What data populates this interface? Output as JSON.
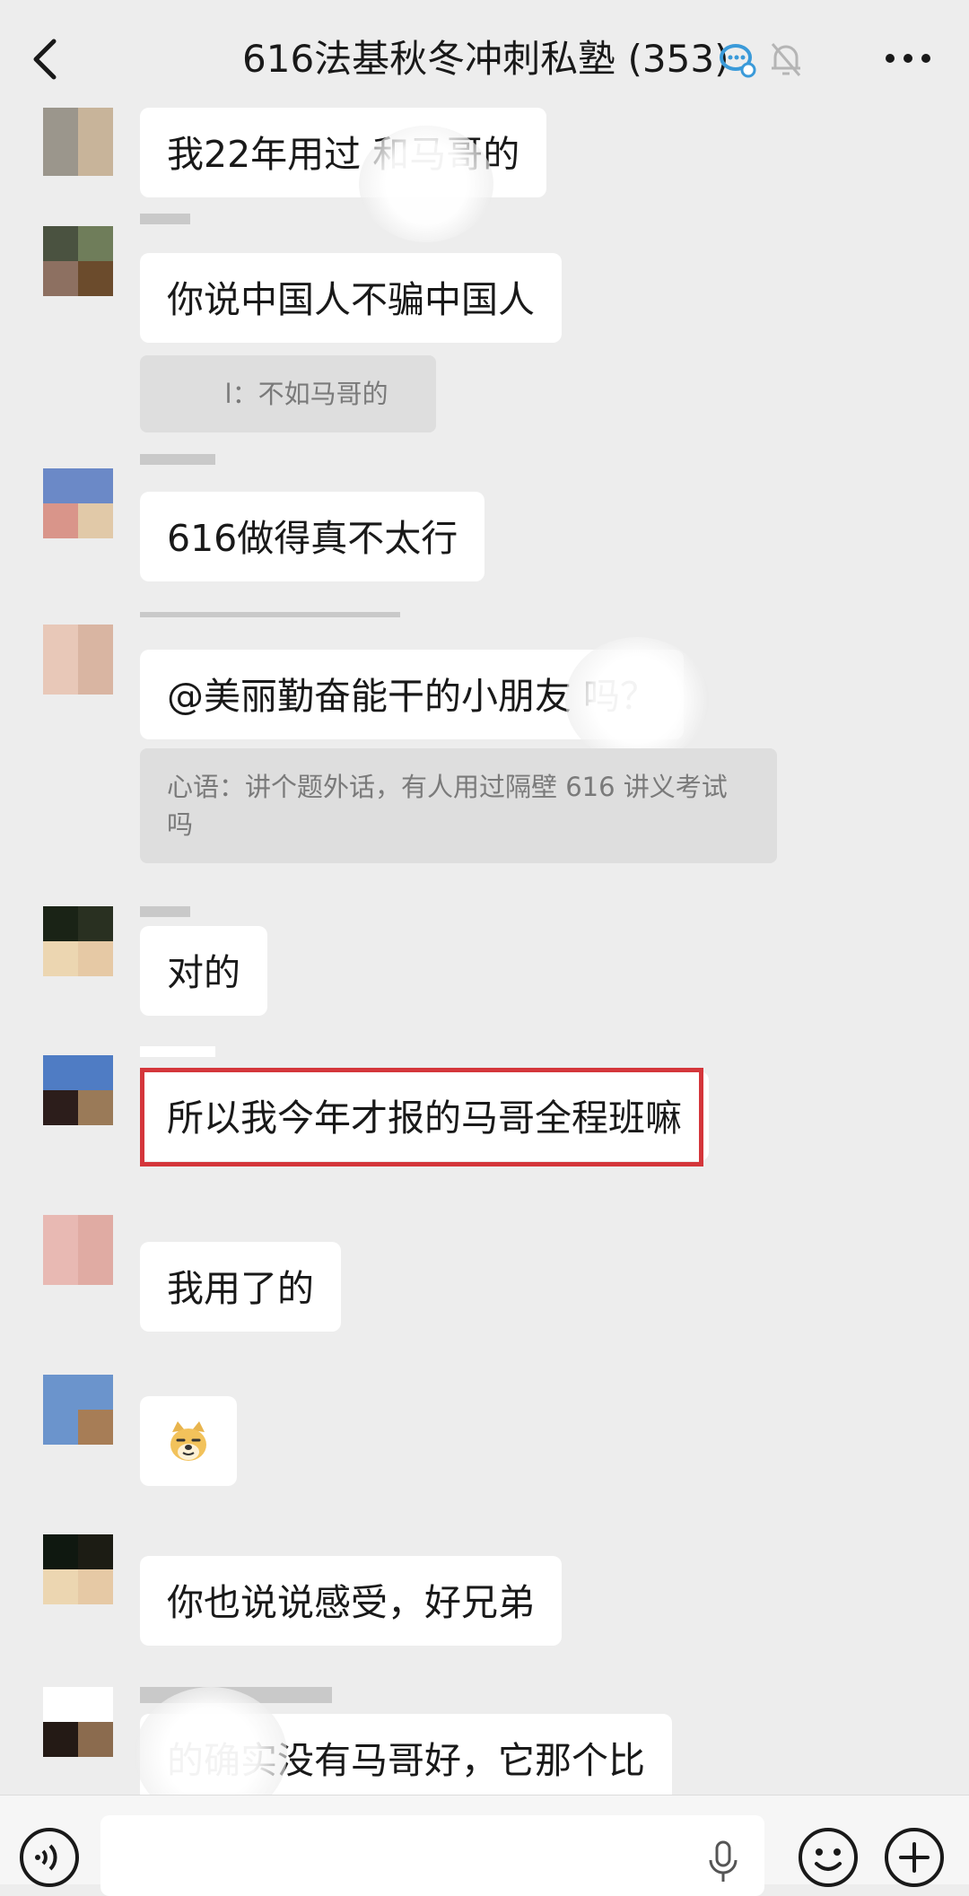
{
  "header": {
    "title": "616法基秋冬冲刺私塾 (353)",
    "back_icon": "chevron-left-icon",
    "status_icons": [
      "group-chat-icon",
      "mute-bell-icon"
    ],
    "more_icon": "more-dots-icon"
  },
  "messages": [
    {
      "text": "我22年用过        和马哥的",
      "avatar": [
        "#9b968c",
        "#c8b49a",
        "#9b968c",
        "#c8b49a"
      ]
    },
    {
      "text": "你说中国人不骗中国人",
      "avatar": [
        "#4a5240",
        "#6f7d5a",
        "#8d7061",
        "#6b4b2c"
      ],
      "quote": "       l：不如马哥的"
    },
    {
      "text": "616做得真不太行",
      "avatar": [
        "#6b89c7",
        "#6b89c7",
        "#d9958a",
        "#e1c9a8"
      ]
    },
    {
      "text": "@美丽勤奋能干的小朋友        吗？",
      "avatar": [
        "#e8c8b8",
        "#d9b5a2",
        "#e8c8b8",
        "#d9b5a2"
      ],
      "quote": "心语：讲个题外话，有人用过隔壁 616 讲义考试吗"
    },
    {
      "text": "对的",
      "avatar": [
        "#1a2316",
        "#293021",
        "#ecd6b1",
        "#e6c9a5"
      ]
    },
    {
      "text": "所以我今年才报的马哥全程班嘛",
      "avatar": [
        "#4f7cc4",
        "#4f7cc4",
        "#2c1d1b",
        "#9a7a58"
      ],
      "highlighted": true
    },
    {
      "text": "我用了的",
      "avatar": [
        "#e8b9b3",
        "#e0aba3",
        "#e8b9b3",
        "#e0aba3"
      ]
    },
    {
      "text": "",
      "emoji": "doge-emoji",
      "avatar": [
        "#6b94cc",
        "#6b94cc",
        "#6b94cc",
        "#a77d56"
      ]
    },
    {
      "text": "你也说说感受，好兄弟",
      "avatar": [
        "#0f1810",
        "#1c1c14",
        "#ecd6b1",
        "#e6c9a5"
      ]
    },
    {
      "text": "  的确实没有马哥好，它那个比",
      "avatar": [
        "#ffffff",
        "#ffffff",
        "#241a15",
        "#8b6b4e"
      ]
    }
  ],
  "input_bar": {
    "voice_icon": "voice-input-icon",
    "mic_icon": "microphone-icon",
    "emoji_icon": "emoji-smile-icon",
    "plus_icon": "plus-circle-icon",
    "placeholder": ""
  },
  "colors": {
    "background": "#ededed",
    "bubble": "#ffffff",
    "quote": "#dedede",
    "highlight": "#d4363b"
  }
}
